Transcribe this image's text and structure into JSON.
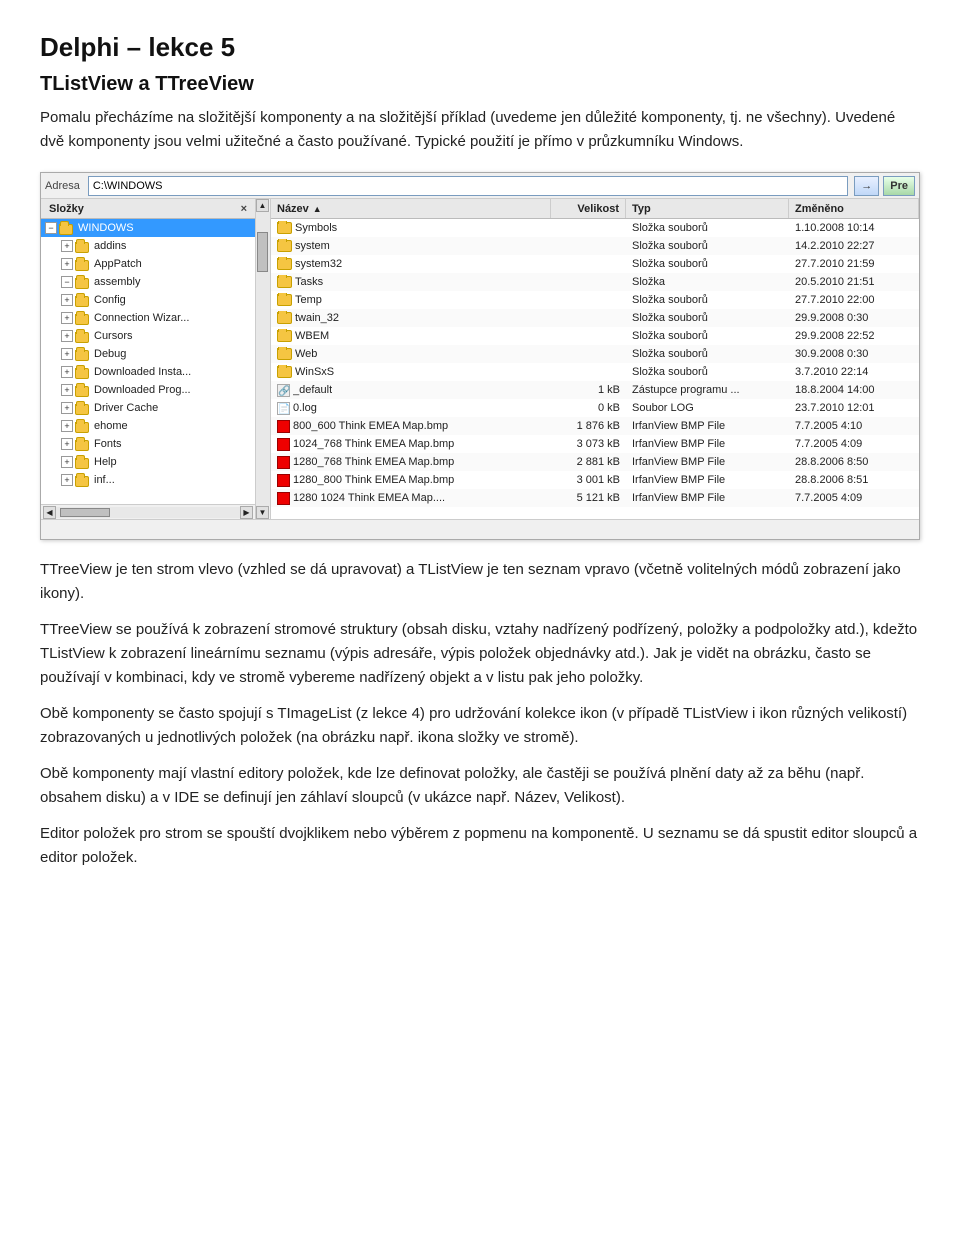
{
  "title": "Delphi – lekce 5",
  "subtitle": "TListView a TTreeView",
  "paragraphs": {
    "p1": "Pomalu přecházíme na složitější komponenty a na složitější příklad (uvedeme jen důležité komponenty, tj.  ne všechny). Uvedené dvě komponenty jsou velmi užitečné a často používané. Typické použití je přímo v průzkumníku Windows.",
    "p2": "TTreeView je ten strom vlevo (vzhled se dá upravovat) a TListView je ten seznam vpravo (včetně volitelných módů zobrazení jako ikony).",
    "p3": "TTreeView se používá k zobrazení stromové struktury (obsah disku, vztahy nadřízený podřízený, položky a podpoložky atd.), kdežto TListView k zobrazení lineárnímu seznamu (výpis adresáře, výpis položek objednávky atd.). Jak je vidět na obrázku, často se používají v kombinaci, kdy ve stromě vybereme nadřízený objekt a v listu pak jeho položky.",
    "p4": "Obě komponenty se často spojují s TImageList (z lekce 4) pro udržování kolekce ikon (v případě TListView i ikon různých velikostí) zobrazovaných u jednotlivých položek (na obrázku např. ikona složky ve stromě).",
    "p5": "Obě komponenty mají vlastní editory položek, kde lze definovat položky, ale častěji se používá plnění daty až za běhu (např. obsahem disku) a v IDE se definují jen záhlaví sloupců (v ukázce např. Název, Velikost).",
    "p6": "Editor položek pro strom se spouští dvojklikem nebo výběrem z popmenu na komponentě. U seznamu se dá spustit editor sloupců a editor položek."
  },
  "explorer": {
    "address_label": "Adresa",
    "address_value": "C:\\WINDOWS",
    "go_button": "→",
    "pre_button": "Pre",
    "tree_header": "Složky",
    "tree_header_close": "×",
    "tree_items": [
      {
        "label": "WINDOWS",
        "indent": 0,
        "expanded": true,
        "selected": true
      },
      {
        "label": "addins",
        "indent": 1,
        "expanded": false
      },
      {
        "label": "AppPatch",
        "indent": 1,
        "expanded": false
      },
      {
        "label": "assembly",
        "indent": 1,
        "expanded": true
      },
      {
        "label": "Config",
        "indent": 1,
        "expanded": false
      },
      {
        "label": "Connection Wizar...",
        "indent": 1,
        "expanded": false
      },
      {
        "label": "Cursors",
        "indent": 1,
        "expanded": false
      },
      {
        "label": "Debug",
        "indent": 1,
        "expanded": false
      },
      {
        "label": "Downloaded Insta...",
        "indent": 1,
        "expanded": false
      },
      {
        "label": "Downloaded Prog...",
        "indent": 1,
        "expanded": false
      },
      {
        "label": "Driver Cache",
        "indent": 1,
        "expanded": false
      },
      {
        "label": "ehome",
        "indent": 1,
        "expanded": false
      },
      {
        "label": "Fonts",
        "indent": 1,
        "expanded": false
      },
      {
        "label": "Help",
        "indent": 1,
        "expanded": false
      },
      {
        "label": "inf...",
        "indent": 1,
        "expanded": false
      }
    ],
    "list_columns": [
      {
        "label": "Název",
        "sort": "▲"
      },
      {
        "label": "Velikost",
        "sort": ""
      },
      {
        "label": "Typ",
        "sort": ""
      },
      {
        "label": "Změněno",
        "sort": ""
      }
    ],
    "list_items": [
      {
        "name": "Symbols",
        "icon": "folder",
        "size": "",
        "type": "Složka souborů",
        "date": "1.10.2008 10:14"
      },
      {
        "name": "system",
        "icon": "folder",
        "size": "",
        "type": "Složka souborů",
        "date": "14.2.2010 22:27"
      },
      {
        "name": "system32",
        "icon": "folder",
        "size": "",
        "type": "Složka souborů",
        "date": "27.7.2010 21:59"
      },
      {
        "name": "Tasks",
        "icon": "folder",
        "size": "",
        "type": "Složka",
        "date": "20.5.2010 21:51"
      },
      {
        "name": "Temp",
        "icon": "folder",
        "size": "",
        "type": "Složka souborů",
        "date": "27.7.2010 22:00"
      },
      {
        "name": "twain_32",
        "icon": "folder",
        "size": "",
        "type": "Složka souborů",
        "date": "29.9.2008 0:30"
      },
      {
        "name": "WBEM",
        "icon": "folder",
        "size": "",
        "type": "Složka souborů",
        "date": "29.9.2008 22:52"
      },
      {
        "name": "Web",
        "icon": "folder",
        "size": "",
        "type": "Složka souborů",
        "date": "30.9.2008 0:30"
      },
      {
        "name": "WinSxS",
        "icon": "folder",
        "size": "",
        "type": "Složka souborů",
        "date": "3.7.2010 22:14"
      },
      {
        "name": "_default",
        "icon": "link",
        "size": "1 kB",
        "type": "Zástupce programu ...",
        "date": "18.8.2004 14:00"
      },
      {
        "name": "0.log",
        "icon": "log",
        "size": "0 kB",
        "type": "Soubor LOG",
        "date": "23.7.2010 12:01"
      },
      {
        "name": "800_600 Think EMEA Map.bmp",
        "icon": "bmp",
        "size": "1 876 kB",
        "type": "IrfanView BMP File",
        "date": "7.7.2005 4:10"
      },
      {
        "name": "1024_768 Think EMEA Map.bmp",
        "icon": "bmp",
        "size": "3 073 kB",
        "type": "IrfanView BMP File",
        "date": "7.7.2005 4:09"
      },
      {
        "name": "1280_768 Think EMEA Map.bmp",
        "icon": "bmp",
        "size": "2 881 kB",
        "type": "IrfanView BMP File",
        "date": "28.8.2006 8:50"
      },
      {
        "name": "1280_800 Think EMEA Map.bmp",
        "icon": "bmp",
        "size": "3 001 kB",
        "type": "IrfanView BMP File",
        "date": "28.8.2006 8:51"
      },
      {
        "name": "1280  1024 Think EMEA Map....",
        "icon": "bmp",
        "size": "5 121 kB",
        "type": "IrfanView BMP File",
        "date": "7.7.2005 4:09"
      }
    ]
  }
}
